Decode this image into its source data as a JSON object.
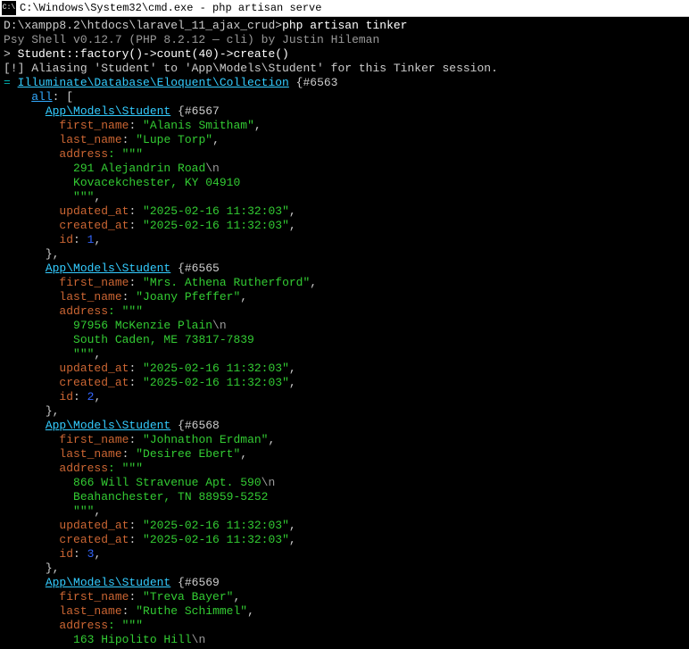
{
  "window": {
    "title": "C:\\Windows\\System32\\cmd.exe - php  artisan serve",
    "icon_label": "cmd"
  },
  "prompt": {
    "path": "D:\\xampp8.2\\htdocs\\laravel_11_ajax_crud>",
    "command": "php artisan tinker"
  },
  "shell_info": "Psy Shell v0.12.7 (PHP 8.2.12 — cli) by Justin Hileman",
  "tinker_cmd": {
    "prompt": "> ",
    "text": "Student::factory()->count(40)->create()"
  },
  "alias_msg": "[!] Aliasing 'Student' to 'App\\Models\\Student' for this Tinker session.",
  "eq": "= ",
  "collection_class": "Illuminate\\Database\\Eloquent\\Collection",
  "collection_hash": " {#6563",
  "all_key": "all",
  "all_punct": ": [",
  "model_class": "App\\Models\\Student",
  "hashes": {
    "s1": " {#6567",
    "s2": " {#6565",
    "s3": " {#6568",
    "s4": " {#6569"
  },
  "keys": {
    "first_name": "first_name",
    "last_name": "last_name",
    "address": "address",
    "updated_at": "updated_at",
    "created_at": "created_at",
    "id": "id"
  },
  "students": {
    "s1": {
      "first_name": "\"Alanis Smitham\"",
      "last_name": "\"Lupe Torp\"",
      "addr_open": ": \"\"\"",
      "addr_line1": "291 Alejandrin Road",
      "addr_line2": "Kovacekchester, KY 04910",
      "addr_close": "\"\"\"",
      "updated_at": "\"2025-02-16 11:32:03\"",
      "created_at": "\"2025-02-16 11:32:03\"",
      "id": "1"
    },
    "s2": {
      "first_name": "\"Mrs. Athena Rutherford\"",
      "last_name": "\"Joany Pfeffer\"",
      "addr_open": ": \"\"\"",
      "addr_line1": "97956 McKenzie Plain",
      "addr_line2": "South Caden, ME 73817-7839",
      "addr_close": "\"\"\"",
      "updated_at": "\"2025-02-16 11:32:03\"",
      "created_at": "\"2025-02-16 11:32:03\"",
      "id": "2"
    },
    "s3": {
      "first_name": "\"Johnathon Erdman\"",
      "last_name": "\"Desiree Ebert\"",
      "addr_open": ": \"\"\"",
      "addr_line1": "866 Will Stravenue Apt. 590",
      "addr_line2": "Beahanchester, TN 88959-5252",
      "addr_close": "\"\"\"",
      "updated_at": "\"2025-02-16 11:32:03\"",
      "created_at": "\"2025-02-16 11:32:03\"",
      "id": "3"
    },
    "s4": {
      "first_name": "\"Treva Bayer\"",
      "last_name": "\"Ruthe Schimmel\"",
      "addr_open": ": \"\"\"",
      "addr_line1": "163 Hipolito Hill"
    }
  },
  "escseq": "\\n",
  "comma": ",",
  "colon_space": ": ",
  "closebrace_comma": "},"
}
